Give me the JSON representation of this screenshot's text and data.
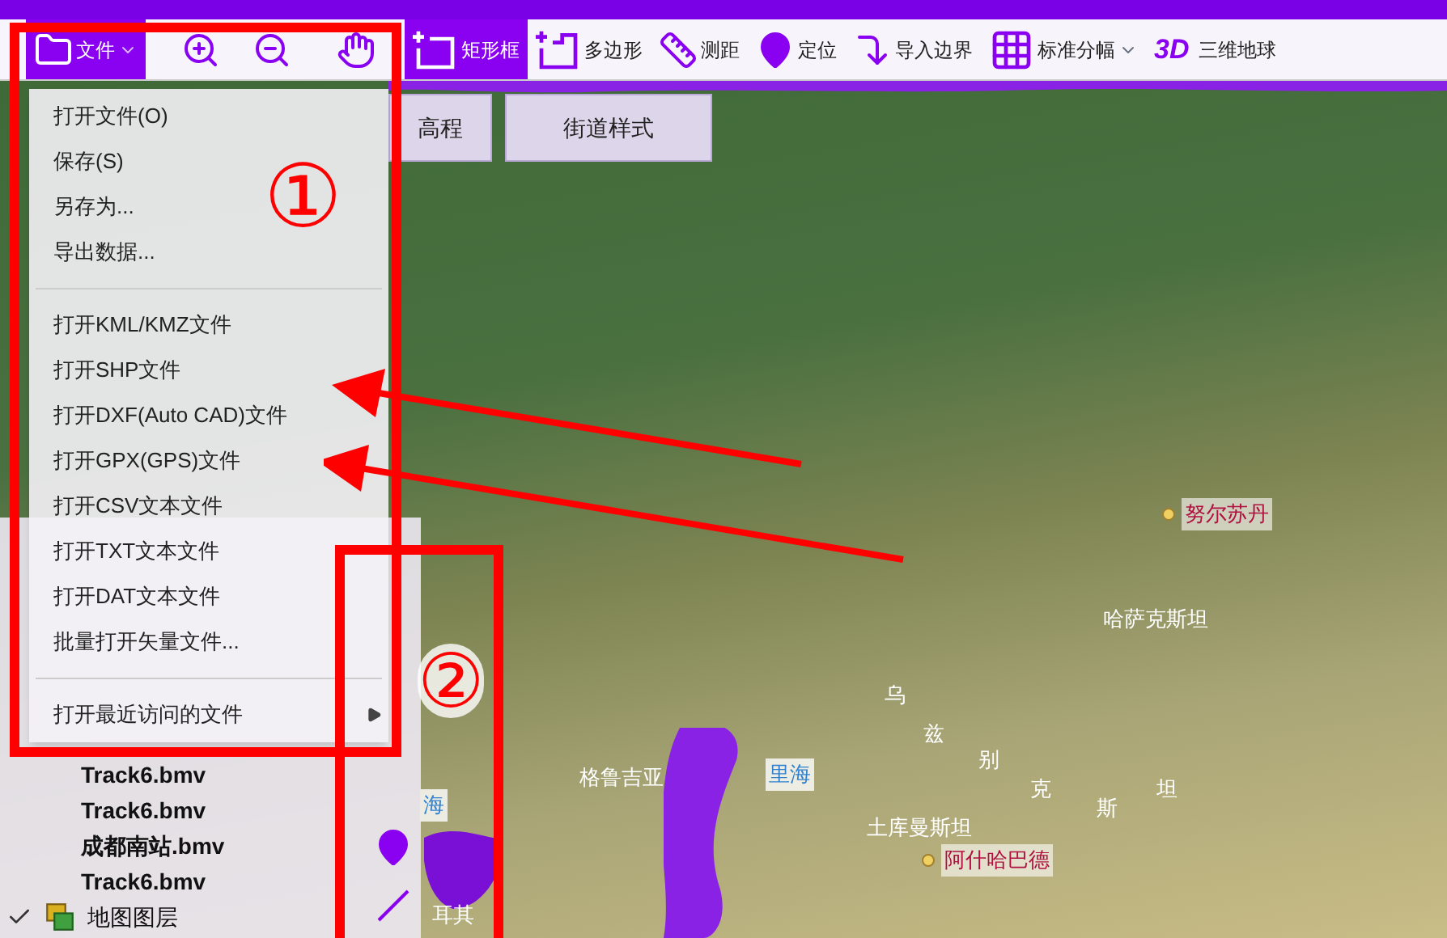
{
  "toolbar": [
    {
      "kind": "file",
      "label": "文件",
      "selected": true
    },
    {
      "kind": "zoom-in",
      "selected": false
    },
    {
      "kind": "zoom-out",
      "selected": false
    },
    {
      "kind": "pan",
      "selected": false
    },
    {
      "kind": "rect",
      "label": "矩形框",
      "selected": true
    },
    {
      "kind": "polygon",
      "label": "多边形",
      "selected": false
    },
    {
      "kind": "measure",
      "label": "测距",
      "selected": false
    },
    {
      "kind": "locate",
      "label": "定位",
      "selected": false
    },
    {
      "kind": "boundary",
      "label": "导入边界",
      "selected": false
    },
    {
      "kind": "grid",
      "label": "标准分幅",
      "selected": false
    },
    {
      "kind": "globe",
      "icon_text": "3D",
      "label": "三维地球",
      "selected": false
    }
  ],
  "map_tabs": [
    {
      "label": "高程"
    },
    {
      "label": "街道样式"
    }
  ],
  "file_menu": [
    {
      "kind": "item",
      "label": "打开文件(O)"
    },
    {
      "kind": "item",
      "label": "保存(S)"
    },
    {
      "kind": "item",
      "label": "另存为..."
    },
    {
      "kind": "item",
      "label": "导出数据..."
    },
    {
      "kind": "separator"
    },
    {
      "kind": "item",
      "label": "打开KML/KMZ文件"
    },
    {
      "kind": "item",
      "label": "打开SHP文件"
    },
    {
      "kind": "item",
      "label": "打开DXF(Auto CAD)文件"
    },
    {
      "kind": "item",
      "label": "打开GPX(GPS)文件"
    },
    {
      "kind": "item",
      "label": "打开CSV文本文件"
    },
    {
      "kind": "item",
      "label": "打开TXT文本文件"
    },
    {
      "kind": "item",
      "label": "打开DAT文本文件"
    },
    {
      "kind": "item",
      "label": "批量打开矢量文件..."
    },
    {
      "kind": "separator"
    },
    {
      "kind": "submenu",
      "label": "打开最近访问的文件"
    }
  ],
  "layer_list": [
    {
      "kind": "file",
      "label": "Track6.bmv"
    },
    {
      "kind": "file",
      "label": "Track6.bmv"
    },
    {
      "kind": "file",
      "label": "成都南站.bmv"
    },
    {
      "kind": "file",
      "label": "Track6.bmv"
    },
    {
      "kind": "group",
      "label": "地图图层",
      "checked": true
    }
  ],
  "map_labels": [
    {
      "label": "努尔苏丹",
      "kind": "city"
    },
    {
      "label": "哈萨克斯坦",
      "kind": "country"
    },
    {
      "label": "乌",
      "kind": "country"
    },
    {
      "label": "兹",
      "kind": "country"
    },
    {
      "label": "别",
      "kind": "country"
    },
    {
      "label": "克",
      "kind": "country"
    },
    {
      "label": "斯",
      "kind": "country"
    },
    {
      "label": "坦",
      "kind": "country"
    },
    {
      "label": "格鲁吉亚",
      "kind": "country"
    },
    {
      "label": "里海",
      "kind": "sea"
    },
    {
      "label": "海",
      "kind": "sea"
    },
    {
      "label": "耳其",
      "kind": "country"
    },
    {
      "label": "土库曼斯坦",
      "kind": "country"
    },
    {
      "label": "阿什哈巴德",
      "kind": "city"
    }
  ],
  "annotations": [
    {
      "label": "①"
    },
    {
      "label": "②"
    }
  ]
}
